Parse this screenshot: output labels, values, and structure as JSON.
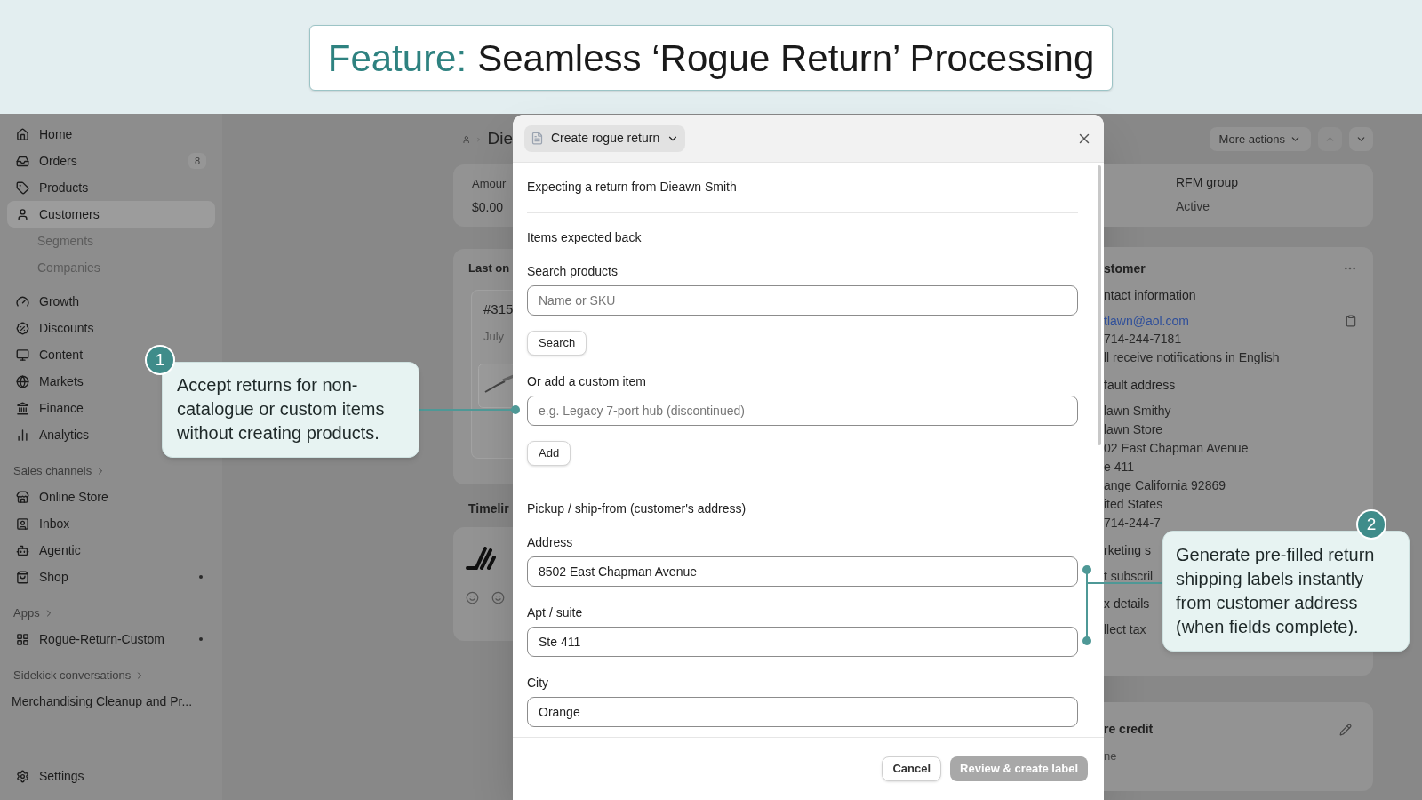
{
  "banner": {
    "label": "Feature:",
    "title": "Seamless ‘Rogue Return’ Processing"
  },
  "sidebar": {
    "entries": [
      {
        "kind": "item",
        "label": "Home",
        "selected": false,
        "dot": false
      },
      {
        "kind": "item",
        "label": "Orders",
        "count": "8",
        "selected": false,
        "dot": false
      },
      {
        "kind": "item",
        "label": "Products",
        "selected": false,
        "dot": false
      },
      {
        "kind": "item",
        "label": "Customers",
        "selected": true,
        "dot": false
      },
      {
        "kind": "subitem",
        "label": "Segments"
      },
      {
        "kind": "subitem",
        "label": "Companies"
      },
      {
        "kind": "item",
        "label": "Growth",
        "selected": false,
        "dot": false
      },
      {
        "kind": "item",
        "label": "Discounts",
        "selected": false,
        "dot": false
      },
      {
        "kind": "item",
        "label": "Content",
        "selected": false,
        "dot": false
      },
      {
        "kind": "item",
        "label": "Markets",
        "selected": false,
        "dot": false
      },
      {
        "kind": "item",
        "label": "Finance",
        "selected": false,
        "dot": false
      },
      {
        "kind": "item",
        "label": "Analytics",
        "selected": false,
        "dot": false
      },
      {
        "kind": "section",
        "label": "Sales channels"
      },
      {
        "kind": "item",
        "label": "Online Store",
        "selected": false,
        "dot": false
      },
      {
        "kind": "item",
        "label": "Inbox",
        "selected": false,
        "dot": false
      },
      {
        "kind": "item",
        "label": "Agentic",
        "selected": false,
        "dot": false
      },
      {
        "kind": "item",
        "label": "Shop",
        "selected": false,
        "dot": true
      },
      {
        "kind": "section",
        "label": "Apps"
      },
      {
        "kind": "item",
        "label": "Rogue-Return-Custom",
        "selected": false,
        "dot": true
      },
      {
        "kind": "section",
        "label": "Sidekick conversations"
      },
      {
        "kind": "conversation",
        "label": "Merchandising Cleanup and Pr..."
      }
    ],
    "footer_item": {
      "label": "Settings"
    }
  },
  "left_panel": {
    "breadcrumb": "Die",
    "amount_card": {
      "label": "Amour",
      "value": "$0.00"
    },
    "orders_card": {
      "title": "Last on",
      "order": "#315",
      "date": "July"
    },
    "timeline_title": "Timelir"
  },
  "right_panel": {
    "more_actions": "More actions",
    "rfm_card": {
      "label": "RFM group",
      "value": "Active"
    },
    "customer_card": {
      "title": "stomer",
      "lines": [
        {
          "kind": "heading",
          "text": "ntact information"
        },
        {
          "kind": "link",
          "text": "tlawn@aol.com"
        },
        {
          "kind": "text",
          "text": "714-244-7181"
        },
        {
          "kind": "text",
          "text": "ll receive notifications in English"
        },
        {
          "kind": "heading",
          "text": "fault address"
        },
        {
          "kind": "text",
          "text": "lawn Smithy"
        },
        {
          "kind": "text",
          "text": "lawn Store"
        },
        {
          "kind": "text",
          "text": "02 East Chapman Avenue"
        },
        {
          "kind": "text",
          "text": "e 411"
        },
        {
          "kind": "text",
          "text": "ange California 92869"
        },
        {
          "kind": "text",
          "text": "ited States"
        },
        {
          "kind": "text",
          "text": "714-244-7"
        },
        {
          "kind": "heading",
          "text": "rketing s"
        },
        {
          "kind": "text",
          "text": "t subscril"
        },
        {
          "kind": "heading",
          "text": "x details"
        },
        {
          "kind": "text",
          "text": "llect tax"
        }
      ]
    },
    "credit_card": {
      "title": "re credit",
      "value": "ne"
    }
  },
  "modal": {
    "title": "Create rogue return",
    "body": [
      {
        "kind": "text",
        "text": "Expecting a return from Dieawn Smith"
      },
      {
        "kind": "divider"
      },
      {
        "kind": "text",
        "text": "Items expected back"
      },
      {
        "kind": "field",
        "label": "Search products",
        "placeholder": "Name or SKU"
      },
      {
        "kind": "button",
        "label": "Search"
      },
      {
        "kind": "field",
        "label": "Or add a custom item",
        "placeholder": "e.g. Legacy 7-port hub (discontinued)"
      },
      {
        "kind": "button",
        "label": "Add"
      },
      {
        "kind": "divider"
      },
      {
        "kind": "text",
        "text": "Pickup / ship-from (customer's address)"
      },
      {
        "kind": "field",
        "label": "Address",
        "value": "8502 East Chapman Avenue"
      },
      {
        "kind": "field",
        "label": "Apt / suite",
        "value": "Ste 411"
      },
      {
        "kind": "field",
        "label": "City",
        "value": "Orange"
      }
    ],
    "actions": [
      {
        "label": "Cancel",
        "disabled": false
      },
      {
        "label": "Review & create label",
        "disabled": true
      }
    ]
  },
  "callouts": [
    {
      "number": "1",
      "text": "Accept returns for non-catalogue or custom items without creating products."
    },
    {
      "number": "2",
      "text": "Generate pre-filled return shipping labels instantly from customer address (when fields complete)."
    }
  ]
}
